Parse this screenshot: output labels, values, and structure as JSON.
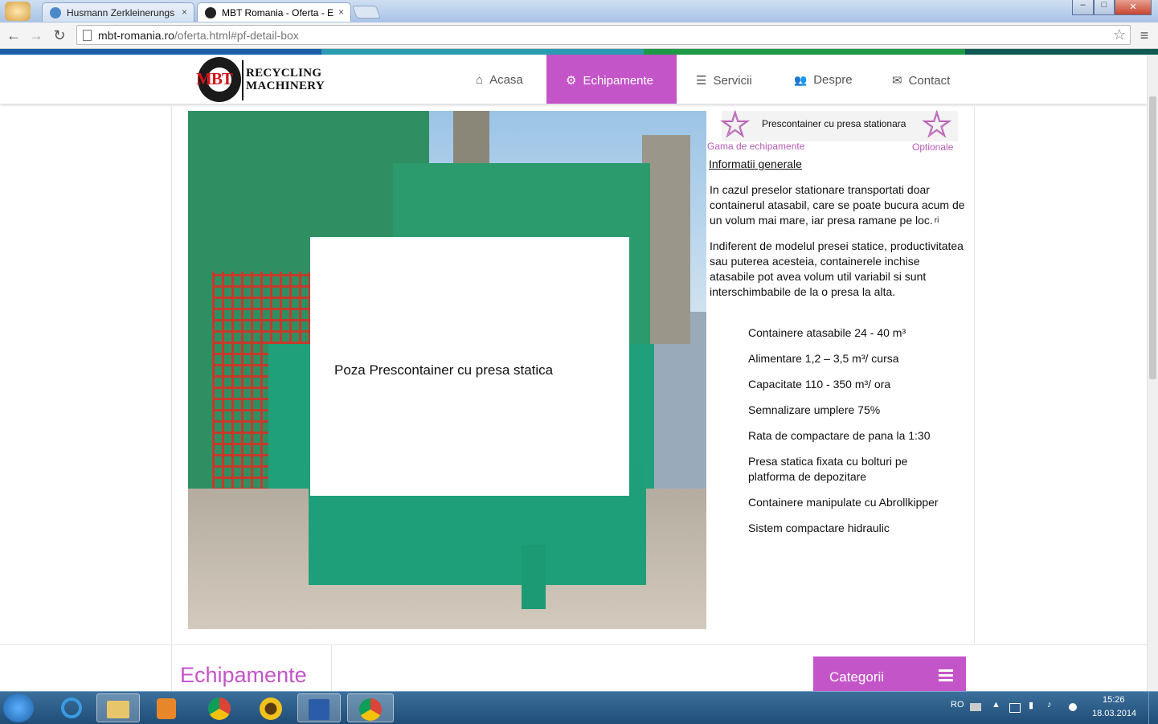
{
  "browser": {
    "tabs": [
      {
        "title": "Husmann Zerkleinerungs",
        "close": "×"
      },
      {
        "title": "MBT Romania - Oferta - E",
        "close": "×"
      }
    ],
    "url_host": "mbt-romania.ro",
    "url_path": "/oferta.html#pf-detail-box",
    "back": "←",
    "forward": "→",
    "reload": "↻",
    "menu": "≡",
    "bookmark": "☆",
    "win_min": "–",
    "win_max": "□",
    "win_close": "✕"
  },
  "site": {
    "logo": {
      "mark": "MBT",
      "line1": "RECYCLING",
      "line2": "MACHINERY"
    },
    "nav": [
      {
        "icon": "⌂",
        "label": "Acasa"
      },
      {
        "icon": "⚙",
        "label": "Echipamente"
      },
      {
        "icon": "☰",
        "label": "Servicii"
      },
      {
        "icon": "👥",
        "label": "Despre"
      },
      {
        "icon": "✉",
        "label": "Contact"
      }
    ],
    "stripe_colors": [
      "#1b5ea8",
      "#2a9bb0",
      "#1c9a46",
      "#0e5a52"
    ],
    "accent": "#c455c8"
  },
  "main": {
    "photo_overlay_text": "Poza Prescontainer cu presa statica",
    "product_title": "Prescontainer cu presa stationara",
    "star_glyph": "☆",
    "left_link": "Gama de echipamente",
    "right_link": "Optionale",
    "info_heading": "Informatii generale",
    "para1": "In cazul  preselor stationare transportati doar containerul atasabil, care se poate bucura acum de un volum mai mare, iar presa ramane pe loc.",
    "para1_suffix": "ri",
    "para2": "Indiferent de modelul presei statice, productivitatea sau puterea acesteia, containerele inchise atasabile pot avea volum util variabil si sunt interschimbabile de la o presa la alta.",
    "features": [
      "Containere atasabile 24 - 40 m³",
      "Alimentare 1,2 – 3,5 m³/ cursa",
      "Capacitate 110 - 350 m³/ ora",
      "Semnalizare umplere 75%",
      "Rata de compactare de pana la 1:30",
      "Presa statica fixata cu bolturi pe platforma de depozitare",
      "Containere manipulate cu Abrollkipper",
      "Sistem compactare hidraulic"
    ],
    "section_title": "Echipamente",
    "category_button": "Categorii"
  },
  "taskbar": {
    "lang": "RO",
    "time": "15:26",
    "date": "18.03.2014"
  }
}
